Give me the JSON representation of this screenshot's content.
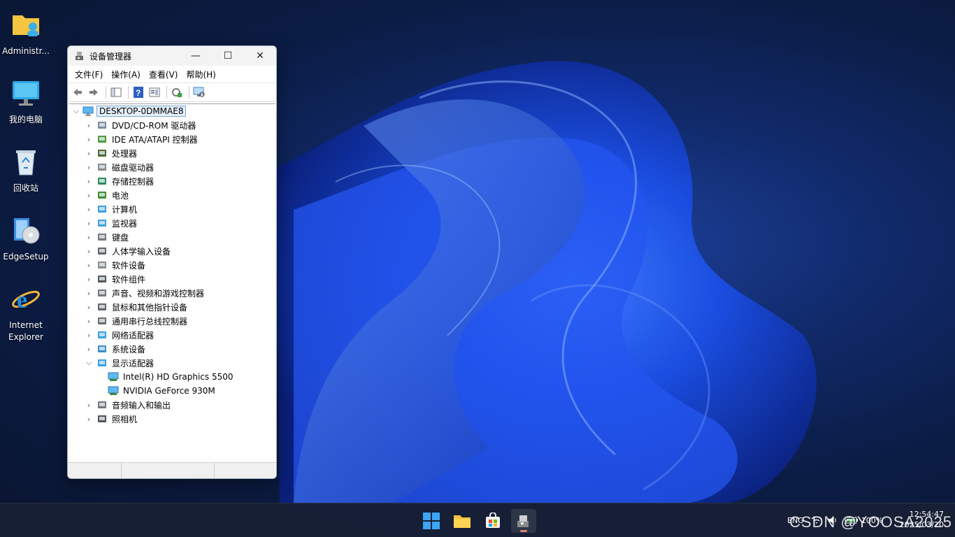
{
  "desktop": {
    "icons": [
      {
        "label": "Administr..."
      },
      {
        "label": "我的电脑"
      },
      {
        "label": "回收站"
      },
      {
        "label": "EdgeSetup"
      },
      {
        "label": "Internet\nExplorer"
      }
    ]
  },
  "window": {
    "title": "设备管理器",
    "controls": {
      "minimize": "—",
      "maximize": "☐",
      "close": "✕"
    },
    "menu": [
      "文件(F)",
      "操作(A)",
      "查看(V)",
      "帮助(H)"
    ],
    "tree": {
      "root": "DESKTOP-0DMMAE8",
      "categories": [
        {
          "label": "DVD/CD-ROM 驱动器",
          "icon": "dvd-drive-icon"
        },
        {
          "label": "IDE ATA/ATAPI 控制器",
          "icon": "ide-controller-icon"
        },
        {
          "label": "处理器",
          "icon": "processor-icon"
        },
        {
          "label": "磁盘驱动器",
          "icon": "disk-drive-icon"
        },
        {
          "label": "存储控制器",
          "icon": "storage-controller-icon"
        },
        {
          "label": "电池",
          "icon": "battery-icon"
        },
        {
          "label": "计算机",
          "icon": "computer-icon"
        },
        {
          "label": "监视器",
          "icon": "monitor-icon"
        },
        {
          "label": "键盘",
          "icon": "keyboard-icon"
        },
        {
          "label": "人体学输入设备",
          "icon": "hid-icon"
        },
        {
          "label": "软件设备",
          "icon": "software-device-icon"
        },
        {
          "label": "软件组件",
          "icon": "software-component-icon"
        },
        {
          "label": "声音、视频和游戏控制器",
          "icon": "sound-icon"
        },
        {
          "label": "鼠标和其他指针设备",
          "icon": "mouse-icon"
        },
        {
          "label": "通用串行总线控制器",
          "icon": "usb-icon"
        },
        {
          "label": "网络适配器",
          "icon": "network-adapter-icon"
        },
        {
          "label": "系统设备",
          "icon": "system-device-icon"
        },
        {
          "label": "显示适配器",
          "icon": "display-adapter-icon",
          "expanded": true,
          "children": [
            "Intel(R) HD Graphics 5500",
            "NVIDIA GeForce 930M"
          ]
        },
        {
          "label": "音频输入和输出",
          "icon": "audio-io-icon"
        },
        {
          "label": "照相机",
          "icon": "camera-icon"
        }
      ]
    }
  },
  "taskbar": {
    "tray": {
      "lang": "ENG",
      "battery": "100%"
    },
    "clock": {
      "time": "12:54:47",
      "date": "2025/03/20"
    },
    "watermark": "CSDN @YOOSA2025"
  }
}
